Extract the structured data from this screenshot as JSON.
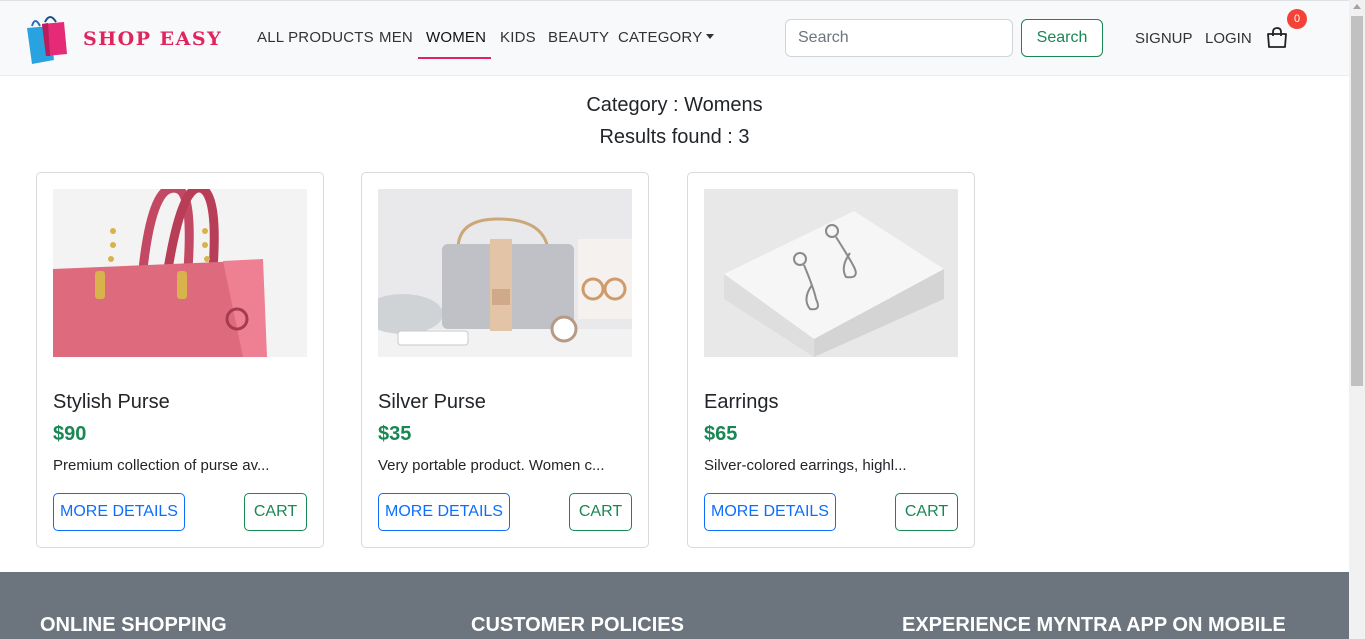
{
  "brand": {
    "name": "SHOP EASY",
    "color": "#e0245e"
  },
  "nav": {
    "all_products": "ALL PRODUCTS",
    "men": "MEN",
    "women": "WOMEN",
    "kids": "KIDS",
    "beauty": "BEAUTY",
    "category": "CATEGORY",
    "active": "WOMEN"
  },
  "search": {
    "placeholder": "Search",
    "button_label": "Search"
  },
  "auth": {
    "signup": "SIGNUP",
    "login": "LOGIN"
  },
  "cart": {
    "count": "0",
    "icon": "shopping-bag-icon"
  },
  "page": {
    "category_line": "Category : Womens",
    "results_line": "Results found : 3"
  },
  "products": [
    {
      "title": "Stylish Purse",
      "price": "$90",
      "description": "Premium collection of purse av...",
      "image": "pink-handbag",
      "details_label": "MORE DETAILS",
      "cart_label": "CART"
    },
    {
      "title": "Silver Purse",
      "price": "$35",
      "description": "Very portable product. Women c...",
      "image": "silver-handbag",
      "details_label": "MORE DETAILS",
      "cart_label": "CART"
    },
    {
      "title": "Earrings",
      "price": "$65",
      "description": "Silver-colored earrings, highl...",
      "image": "silver-earrings",
      "details_label": "MORE DETAILS",
      "cart_label": "CART"
    }
  ],
  "footer": {
    "online_shopping": "ONLINE SHOPPING",
    "customer_policies": "CUSTOMER POLICIES",
    "app": "EXPERIENCE MYNTRA APP ON MOBILE"
  },
  "colors": {
    "accent": "#e0245e",
    "price": "#198754",
    "details": "#0d6efd",
    "footer": "#6c757d"
  }
}
